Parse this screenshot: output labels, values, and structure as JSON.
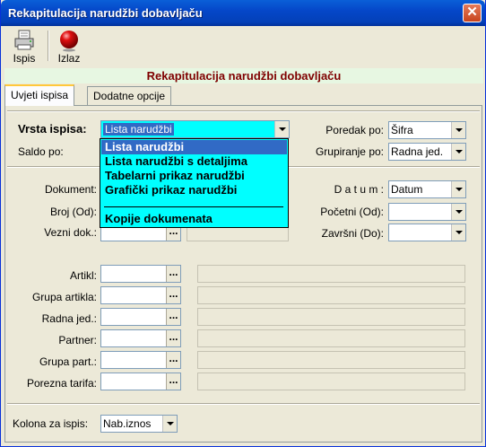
{
  "window": {
    "title": "Rekapitulacija narudžbi dobavljaču",
    "close_glyph": "✕"
  },
  "toolbar": {
    "print_label": "Ispis",
    "exit_label": "Izlaz"
  },
  "banner": "Rekapitulacija narudžbi dobavljaču",
  "tabs": [
    "Uvjeti ispisa",
    "Dodatne opcije"
  ],
  "form": {
    "vrsta_ispisa_label": "Vrsta ispisa:",
    "vrsta_ispisa_value": "Lista narudžbi",
    "saldo_label": "Saldo po:",
    "poredak_label": "Poredak po:",
    "poredak_value": "Šifra",
    "grupiranje_label": "Grupiranje po:",
    "grupiranje_value": "Radna jed.",
    "dokument_label": "Dokument:",
    "broj_label": "Broj (Od):",
    "vezni_label": "Vezni dok.:",
    "datum_label": "D a t u m :",
    "datum_value": "Datum",
    "pocetni_label": "Početni (Od):",
    "zavrsni_label": "Završni (Do):",
    "dots": "...",
    "artikl_label": "Artikl:",
    "grupa_artikla_label": "Grupa artikla:",
    "radna_jed_label": "Radna jed.:",
    "partner_label": "Partner:",
    "grupa_part_label": "Grupa part.:",
    "porezna_label": "Porezna tarifa:",
    "kolona_label": "Kolona za ispis:",
    "kolona_value": "Nab.iznos"
  },
  "dropdown": {
    "items": [
      "Lista narudžbi",
      "Lista narudžbi s detaljima",
      "Tabelarni prikaz narudžbi",
      "Grafički prikaz narudžbi",
      "Kopije dokumenata"
    ]
  }
}
